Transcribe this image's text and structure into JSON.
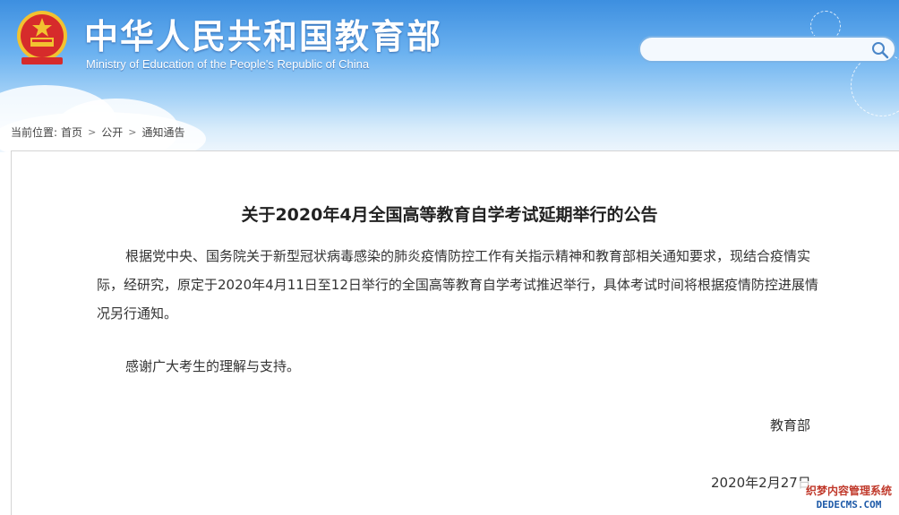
{
  "header": {
    "title_cn": "中华人民共和国教育部",
    "title_en": "Ministry of Education of the People's Republic of China",
    "emblem_icon": "national-emblem-icon"
  },
  "search": {
    "placeholder": "",
    "value": "",
    "icon": "search-icon"
  },
  "breadcrumb": {
    "label": "当前位置:",
    "items": [
      "首页",
      "公开",
      "通知通告"
    ],
    "separator_icon": "chevron-right-icon"
  },
  "article": {
    "title": "关于2020年4月全国高等教育自学考试延期举行的公告",
    "paragraph1": "根据党中央、国务院关于新型冠状病毒感染的肺炎疫情防控工作有关指示精神和教育部相关通知要求，现结合疫情实际，经研究，原定于2020年4月11日至12日举行的全国高等教育自学考试推迟举行，具体考试时间将根据疫情防控进展情况另行通知。",
    "paragraph2": "感谢广大考生的理解与支持。",
    "signature": "教育部",
    "date": "2020年2月27日"
  },
  "watermark": {
    "line1": "织梦内容管理系统",
    "line2": "DEDECMS.COM"
  },
  "colors": {
    "header_top": "#3d8fe0",
    "header_bottom": "#eef6fd",
    "search_border": "#7bb3e6",
    "emblem_red": "#d62b2b",
    "emblem_gold": "#f2c230"
  }
}
